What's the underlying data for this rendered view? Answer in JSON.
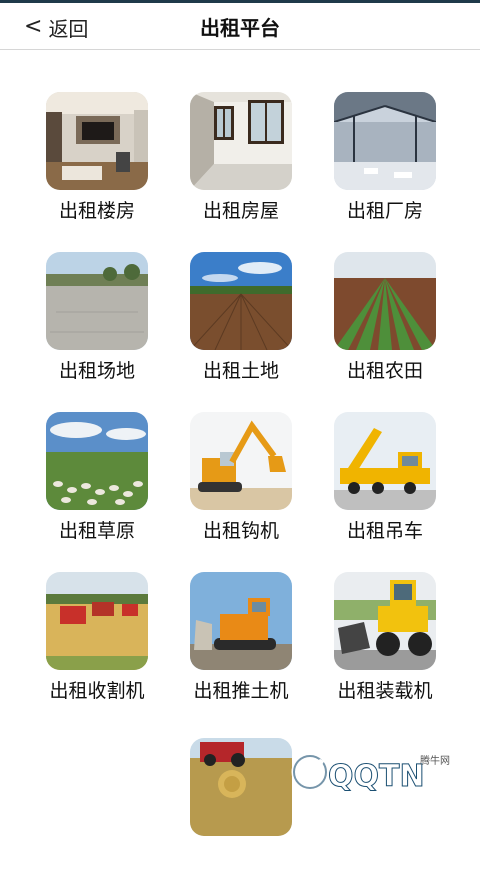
{
  "header": {
    "back_label": "返回",
    "back_icon": "<",
    "title": "出租平台"
  },
  "tiles": [
    {
      "label": "出租楼房"
    },
    {
      "label": "出租房屋"
    },
    {
      "label": "出租厂房"
    },
    {
      "label": "出租场地"
    },
    {
      "label": "出租土地"
    },
    {
      "label": "出租农田"
    },
    {
      "label": "出租草原"
    },
    {
      "label": "出租钩机"
    },
    {
      "label": "出租吊车"
    },
    {
      "label": "出租收割机"
    },
    {
      "label": "出租推土机"
    },
    {
      "label": "出租装载机"
    },
    {
      "label": ""
    }
  ],
  "watermark": {
    "text": "腾牛网",
    "logo": "QQTN.com"
  }
}
